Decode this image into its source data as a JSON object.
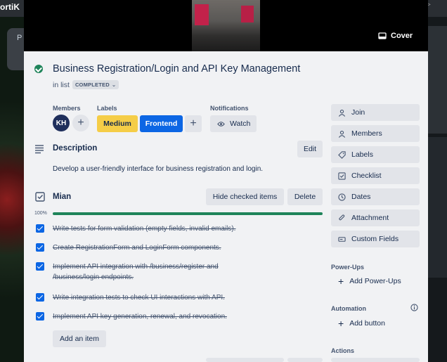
{
  "background": {
    "brand": "ortiK",
    "list_letter": "P"
  },
  "cover": {
    "button_label": "Cover"
  },
  "card": {
    "title": "Business Registration/Login and API Key Management",
    "in_list_prefix": "in list",
    "list_name": "COMPLETED"
  },
  "members": {
    "label": "Members",
    "avatars": [
      "KH"
    ]
  },
  "labels": {
    "label": "Labels",
    "items": [
      {
        "name": "Medium",
        "color": "#f5cd47"
      },
      {
        "name": "Frontend",
        "color": "#0c66e4"
      }
    ]
  },
  "notifications": {
    "label": "Notifications",
    "watch_label": "Watch"
  },
  "description": {
    "title": "Description",
    "edit_label": "Edit",
    "text": "Develop a user-friendly interface for business registration and login."
  },
  "checklist": {
    "title": "Mian",
    "hide_label": "Hide checked items",
    "delete_label": "Delete",
    "progress_text": "100%",
    "progress": 1.0,
    "items": [
      {
        "text": "Write tests for form validation (empty fields, invalid emails).",
        "checked": true
      },
      {
        "text": "Create RegistrationForm and LoginForm components.",
        "checked": true
      },
      {
        "text": "Implement API integration with /business/register and /business/login endpoints.",
        "checked": true
      },
      {
        "text": "Write integration tests to check UI interactions with API.",
        "checked": true
      },
      {
        "text": "Implement API key generation, renewal, and revocation.",
        "checked": true
      }
    ],
    "add_item_label": "Add an item"
  },
  "sidebar": {
    "buttons": [
      {
        "label": "Join",
        "icon": "person-icon"
      },
      {
        "label": "Members",
        "icon": "members-icon"
      },
      {
        "label": "Labels",
        "icon": "tag-icon"
      },
      {
        "label": "Checklist",
        "icon": "checklist-icon"
      },
      {
        "label": "Dates",
        "icon": "clock-icon"
      },
      {
        "label": "Attachment",
        "icon": "paperclip-icon"
      },
      {
        "label": "Custom Fields",
        "icon": "custom-fields-icon"
      }
    ],
    "powerups_heading": "Power-Ups",
    "add_powerups_label": "Add Power-Ups",
    "automation_heading": "Automation",
    "add_button_label": "Add button",
    "actions_heading": "Actions"
  },
  "colors": {
    "accent": "#0c66e4",
    "complete": "#1f845a",
    "modal_bg": "#f1f2f4"
  }
}
